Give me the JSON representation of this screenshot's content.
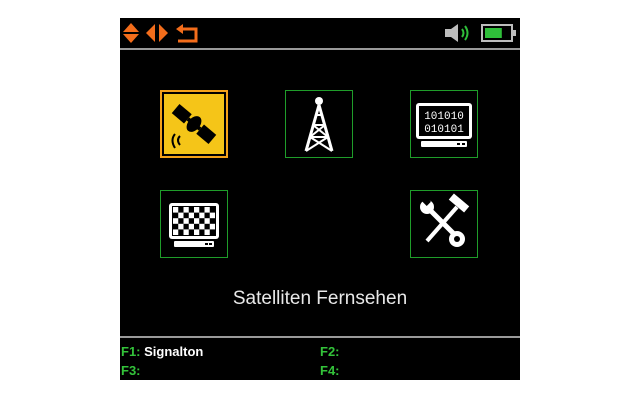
{
  "topbar": {
    "nav_icons": [
      "up-down-arrows-icon",
      "left-right-arrows-icon",
      "back-arrow-icon"
    ],
    "status_icons": [
      "speaker-icon",
      "battery-icon"
    ],
    "accent_color": "#f36d1b",
    "battery_level": 0.7
  },
  "menu": {
    "selected": "satellite-tv",
    "items": [
      {
        "id": "satellite-tv",
        "icon": "satellite-icon"
      },
      {
        "id": "terrestrial-tv",
        "icon": "antenna-tower-icon"
      },
      {
        "id": "data-stream",
        "icon": "binary-display-icon"
      },
      {
        "id": "display-test",
        "icon": "checkerboard-display-icon"
      },
      {
        "id": "tools",
        "icon": "tools-icon"
      }
    ],
    "caption": "Satelliten Fernsehen"
  },
  "function_keys": [
    {
      "key": "F1:",
      "label": "Signalton"
    },
    {
      "key": "F2:",
      "label": ""
    },
    {
      "key": "F3:",
      "label": ""
    },
    {
      "key": "F4:",
      "label": ""
    }
  ],
  "colors": {
    "screen_bg": "#000000",
    "tile_border": "#1f9d2a",
    "selected_bg": "#f5c518",
    "selected_border": "#f3a21a",
    "fkey_color": "#33c33a",
    "battery_color": "#2fbf3a"
  }
}
